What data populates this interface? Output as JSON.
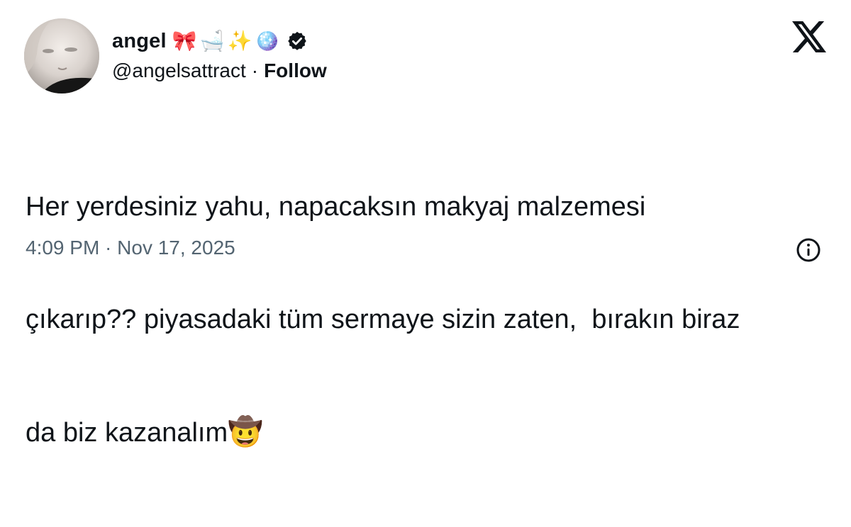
{
  "author": {
    "name": "angel",
    "name_emojis": [
      "🎀",
      "🛁",
      "✨",
      "🪩"
    ],
    "handle": "@angelsattract",
    "separator": "·",
    "follow_label": "Follow",
    "verified": true
  },
  "tweet": {
    "lines": [
      "Her yerdesiniz yahu, napacaksın makyaj malzemesi",
      "çıkarıp?? piyasadaki tüm sermaye sizin zaten,  bırakın biraz",
      "da biz kazanalım"
    ],
    "trailing_emoji": "🤠"
  },
  "meta": {
    "timestamp": "4:09 PM · Nov 17, 2025"
  },
  "icons": {
    "logo": "x-logo-icon",
    "verified": "verified-badge-icon",
    "info": "info-icon"
  },
  "colors": {
    "text": "#0f1419",
    "muted": "#536471",
    "background": "#ffffff"
  }
}
